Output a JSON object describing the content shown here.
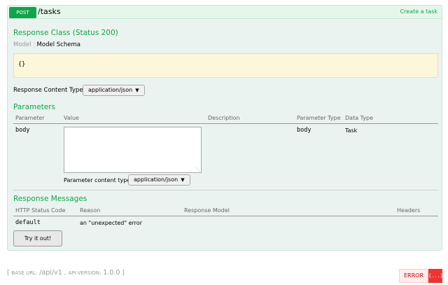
{
  "operation": {
    "method": "POST",
    "path": "/tasks",
    "summary": "Create a task"
  },
  "response_class": {
    "heading": "Response Class (Status 200)",
    "tabs": [
      "Model",
      "Model Schema"
    ],
    "schema": "{}"
  },
  "response_content_type": {
    "label": "Response Content Type",
    "value": "application/json"
  },
  "parameters": {
    "heading": "Parameters",
    "columns": [
      "Parameter",
      "Value",
      "Description",
      "Parameter Type",
      "Data Type"
    ],
    "rows": [
      {
        "name": "body",
        "value": "",
        "description": "",
        "param_type": "body",
        "data_type": "Task",
        "content_type_label": "Parameter content type:",
        "content_type_value": "application/json"
      }
    ]
  },
  "response_messages": {
    "heading": "Response Messages",
    "columns": [
      "HTTP Status Code",
      "Reason",
      "Response Model",
      "Headers"
    ],
    "rows": [
      {
        "code": "default",
        "reason": "an \"unexpected\" error",
        "model": "",
        "headers": ""
      }
    ]
  },
  "try_button": "Try it out!",
  "footer": {
    "open": "[",
    "base_url_label": "BASE URL:",
    "base_url": "/api/v1",
    "sep": ",",
    "api_version_label": "API VERSION:",
    "api_version": "1.0.0",
    "close": "]"
  },
  "validator": {
    "label": "ERROR",
    "icon": "{...}"
  },
  "colors": {
    "accent": "#10a54a",
    "panel_bg": "#ebf3f0",
    "schema_bg": "#fcf6db",
    "error": "#cc0000"
  }
}
